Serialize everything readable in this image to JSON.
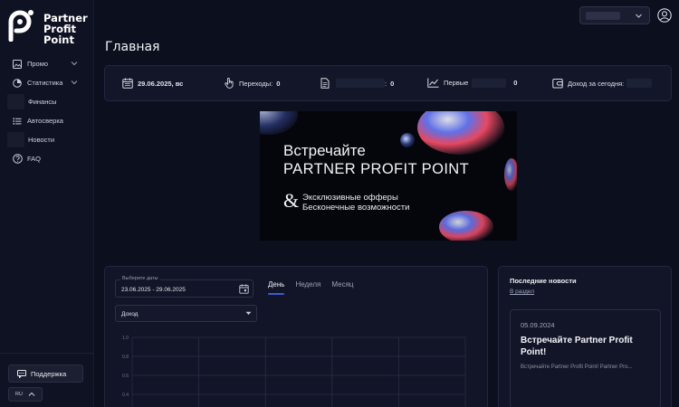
{
  "app": {
    "logo_lines": [
      "Partner",
      "Profit",
      "Point"
    ],
    "page_title": "Главная"
  },
  "sidebar": {
    "items": [
      {
        "label": "Промо",
        "icon": "image-icon",
        "has_submenu": true
      },
      {
        "label": "Статистика",
        "icon": "pie-chart-icon",
        "has_submenu": true
      },
      {
        "label": "Финансы",
        "icon": "wallet-icon",
        "has_submenu": false
      },
      {
        "label": "Автосверка",
        "icon": "list-icon",
        "has_submenu": false
      },
      {
        "label": "Новости",
        "icon": "news-icon",
        "has_submenu": false
      },
      {
        "label": "FAQ",
        "icon": "help-icon",
        "has_submenu": false
      }
    ],
    "support_label": "Поддержка",
    "language": "RU"
  },
  "stats": {
    "date": "29.06.2025, вс",
    "clicks_label": "Переходы:",
    "clicks_value": "0",
    "registrations_value": "0",
    "first_label": "Первые",
    "first_value": "0",
    "income_label": "Доход за сегодня:"
  },
  "banner": {
    "line1": "Встречайте",
    "line2": "PARTNER PROFIT POINT",
    "amp": "&",
    "line3": "Эксклюзивные офферы",
    "line4": "Бесконечные возможности"
  },
  "chart_panel": {
    "date_label": "Выберите даты",
    "date_value": "23.06.2025 - 29.06.2025",
    "tabs": [
      "День",
      "Неделя",
      "Месяц"
    ],
    "active_tab": "День",
    "metric": "Доход"
  },
  "chart_data": {
    "type": "line",
    "y_ticks": [
      "1.0",
      "0.8",
      "0.6",
      "0.4"
    ],
    "series": []
  },
  "news": {
    "title": "Последние новости",
    "link": "В раздел",
    "items": [
      {
        "date": "05.09.2024",
        "headline": "Встречайте Partner Profit Point!",
        "excerpt": "Встречайте Partner Profit Point! Partner Pro..."
      }
    ]
  },
  "colors": {
    "background": "#0c0f1e",
    "accent": "#3c5ad6",
    "card": "#121527"
  }
}
